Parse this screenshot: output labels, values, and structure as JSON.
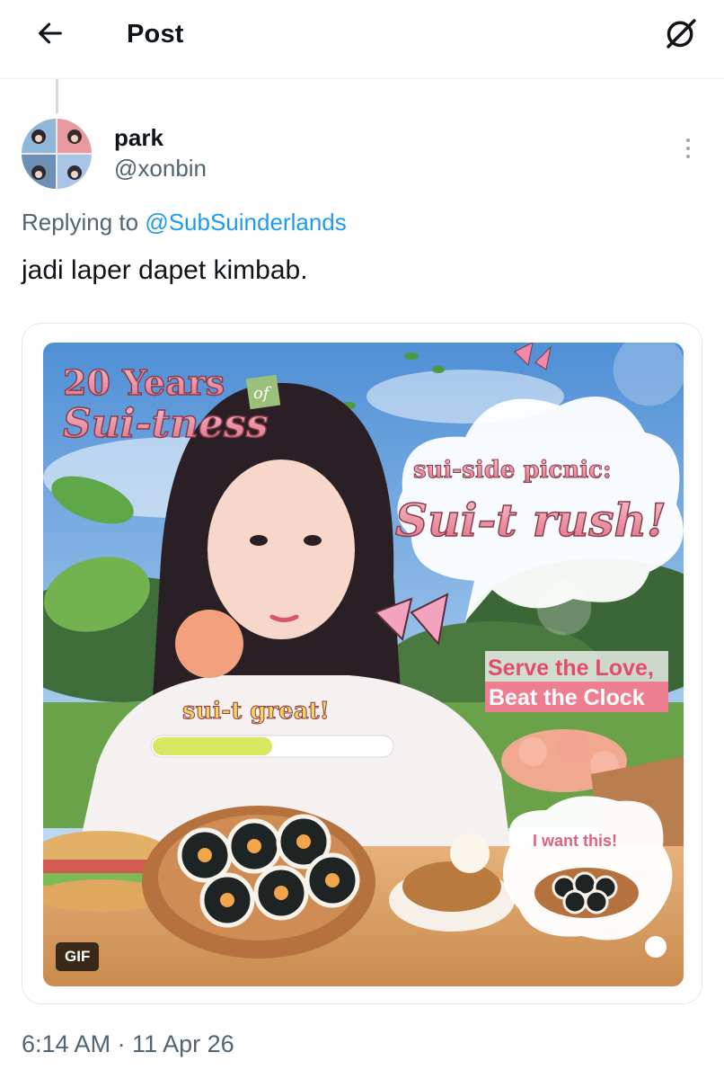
{
  "header": {
    "title": "Post",
    "back_icon": "arrow-left-icon",
    "grok_icon": "grok-icon"
  },
  "author": {
    "name": "park",
    "handle": "@xonbin"
  },
  "reply": {
    "prefix": "Replying to ",
    "handle": "@SubSuinderlands"
  },
  "post": {
    "text": "jadi laper dapet kimbab."
  },
  "media": {
    "type": "gif",
    "badge": "GIF",
    "title_line1": "20 Years",
    "title_small": "of",
    "title_line2": "Sui-tness",
    "bubble_line1": "sui-side picnic:",
    "bubble_line2": "Sui-t rush!",
    "serve_line1": "Serve the Love,",
    "serve_line2": "Beat the Clock",
    "great_text": "sui-t great!",
    "want_text": "I want this!",
    "progress_fraction": 0.5
  },
  "meta": {
    "timestamp": "6:14 AM · 11 Apr 26"
  },
  "colors": {
    "link": "#1d9bf0",
    "muted": "#536471",
    "pink": "#e8708a",
    "progress": "#d8e860"
  }
}
